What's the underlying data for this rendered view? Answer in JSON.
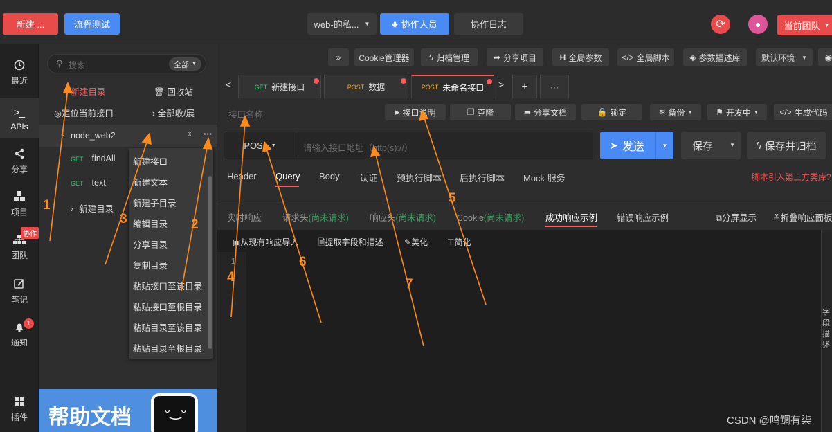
{
  "topbar": {
    "new_btn": "新建 ...",
    "flow_btn": "流程测试",
    "project_select": "web-的私...",
    "collab_btn": "协作人员",
    "collab_log": "协作日志",
    "team_btn": "当前团队"
  },
  "sidebar": {
    "items": [
      {
        "label": "最近",
        "icon": "clock-icon"
      },
      {
        "label": "APIs",
        "icon": "terminal-icon"
      },
      {
        "label": "分享",
        "icon": "share-icon"
      },
      {
        "label": "项目",
        "icon": "project-icon"
      },
      {
        "label": "团队",
        "icon": "team-icon",
        "badge": "协作"
      },
      {
        "label": "笔记",
        "icon": "note-icon"
      },
      {
        "label": "通知",
        "icon": "bell-icon",
        "badge": "1"
      },
      {
        "label": "插件",
        "icon": "plugin-icon"
      }
    ]
  },
  "tree": {
    "search_placeholder": "搜索",
    "filter": "全部",
    "new_dir": "新建目录",
    "recycle": "回收站",
    "locate": "定位当前接口",
    "collapse": "全部收/展",
    "root": "node_web2",
    "items": [
      {
        "method": "GET",
        "name": "findAll"
      },
      {
        "method": "GET",
        "name": "text"
      }
    ],
    "subdir": "新建目录",
    "help": "帮助文档"
  },
  "context_menu": {
    "items": [
      "新建接口",
      "新建文本",
      "新建子目录",
      "编辑目录",
      "分享目录",
      "复制目录",
      "粘贴接口至该目录",
      "粘贴接口至根目录",
      "粘贴目录至该目录",
      "粘贴目录至根目录"
    ]
  },
  "toolbar": {
    "expand": "»",
    "cookie": "Cookie管理器",
    "archive": "归档管理",
    "share_project": "分享项目",
    "global_params": "全局参数",
    "global_script": "全局脚本",
    "param_lib": "参数描述库",
    "env": "默认环境"
  },
  "tabs": [
    {
      "method": "GET",
      "name": "新建接口"
    },
    {
      "method": "POST",
      "name": "数据"
    },
    {
      "method": "POST",
      "name": "未命名接口"
    }
  ],
  "tab_controls": {
    "prev": "<",
    "next": ">",
    "add": "+",
    "more": "···"
  },
  "request": {
    "name_placeholder": "接口名称",
    "explain": "接口说明",
    "clone": "克隆",
    "share_doc": "分享文档",
    "lock": "锁定",
    "backup": "备份",
    "status": "开发中",
    "gen_code": "生成代码",
    "method": "POST",
    "url_placeholder": "请输入接口地址（http(s)://）",
    "send": "发送",
    "save": "保存",
    "save_archive": "保存并归档"
  },
  "param_tabs": [
    "Header",
    "Query",
    "Body",
    "认证",
    "预执行脚本",
    "后执行脚本",
    "Mock 服务"
  ],
  "param_tabs_active": "Query",
  "third_party_link": "脚本引入第三方类库?",
  "response_tabs": [
    {
      "label": "实时响应",
      "hint": ""
    },
    {
      "label": "请求头",
      "hint": "(尚未请求)"
    },
    {
      "label": "响应头",
      "hint": "(尚未请求)"
    },
    {
      "label": "Cookie",
      "hint": "(尚未请求)"
    },
    {
      "label": "成功响应示例",
      "hint": ""
    },
    {
      "label": "错误响应示例",
      "hint": ""
    }
  ],
  "response_tools": {
    "split": "分屏显示",
    "fold": "折叠响应面板"
  },
  "editor_tools": {
    "import": "从现有响应导入",
    "extract": "提取字段和描述",
    "beautify": "美化",
    "simplify": "简化"
  },
  "editor": {
    "line_no": "1"
  },
  "right_edge": [
    "字",
    "段",
    "描",
    "述"
  ],
  "annotations": [
    "1",
    "2",
    "3",
    "4",
    "5",
    "6",
    "7"
  ],
  "watermark": "CSDN @鸣鲷有柒",
  "colors": {
    "red": "#e94a4a",
    "blue": "#4a8af4",
    "orange": "#ff8c1a",
    "accent": "#ff5b5b"
  }
}
